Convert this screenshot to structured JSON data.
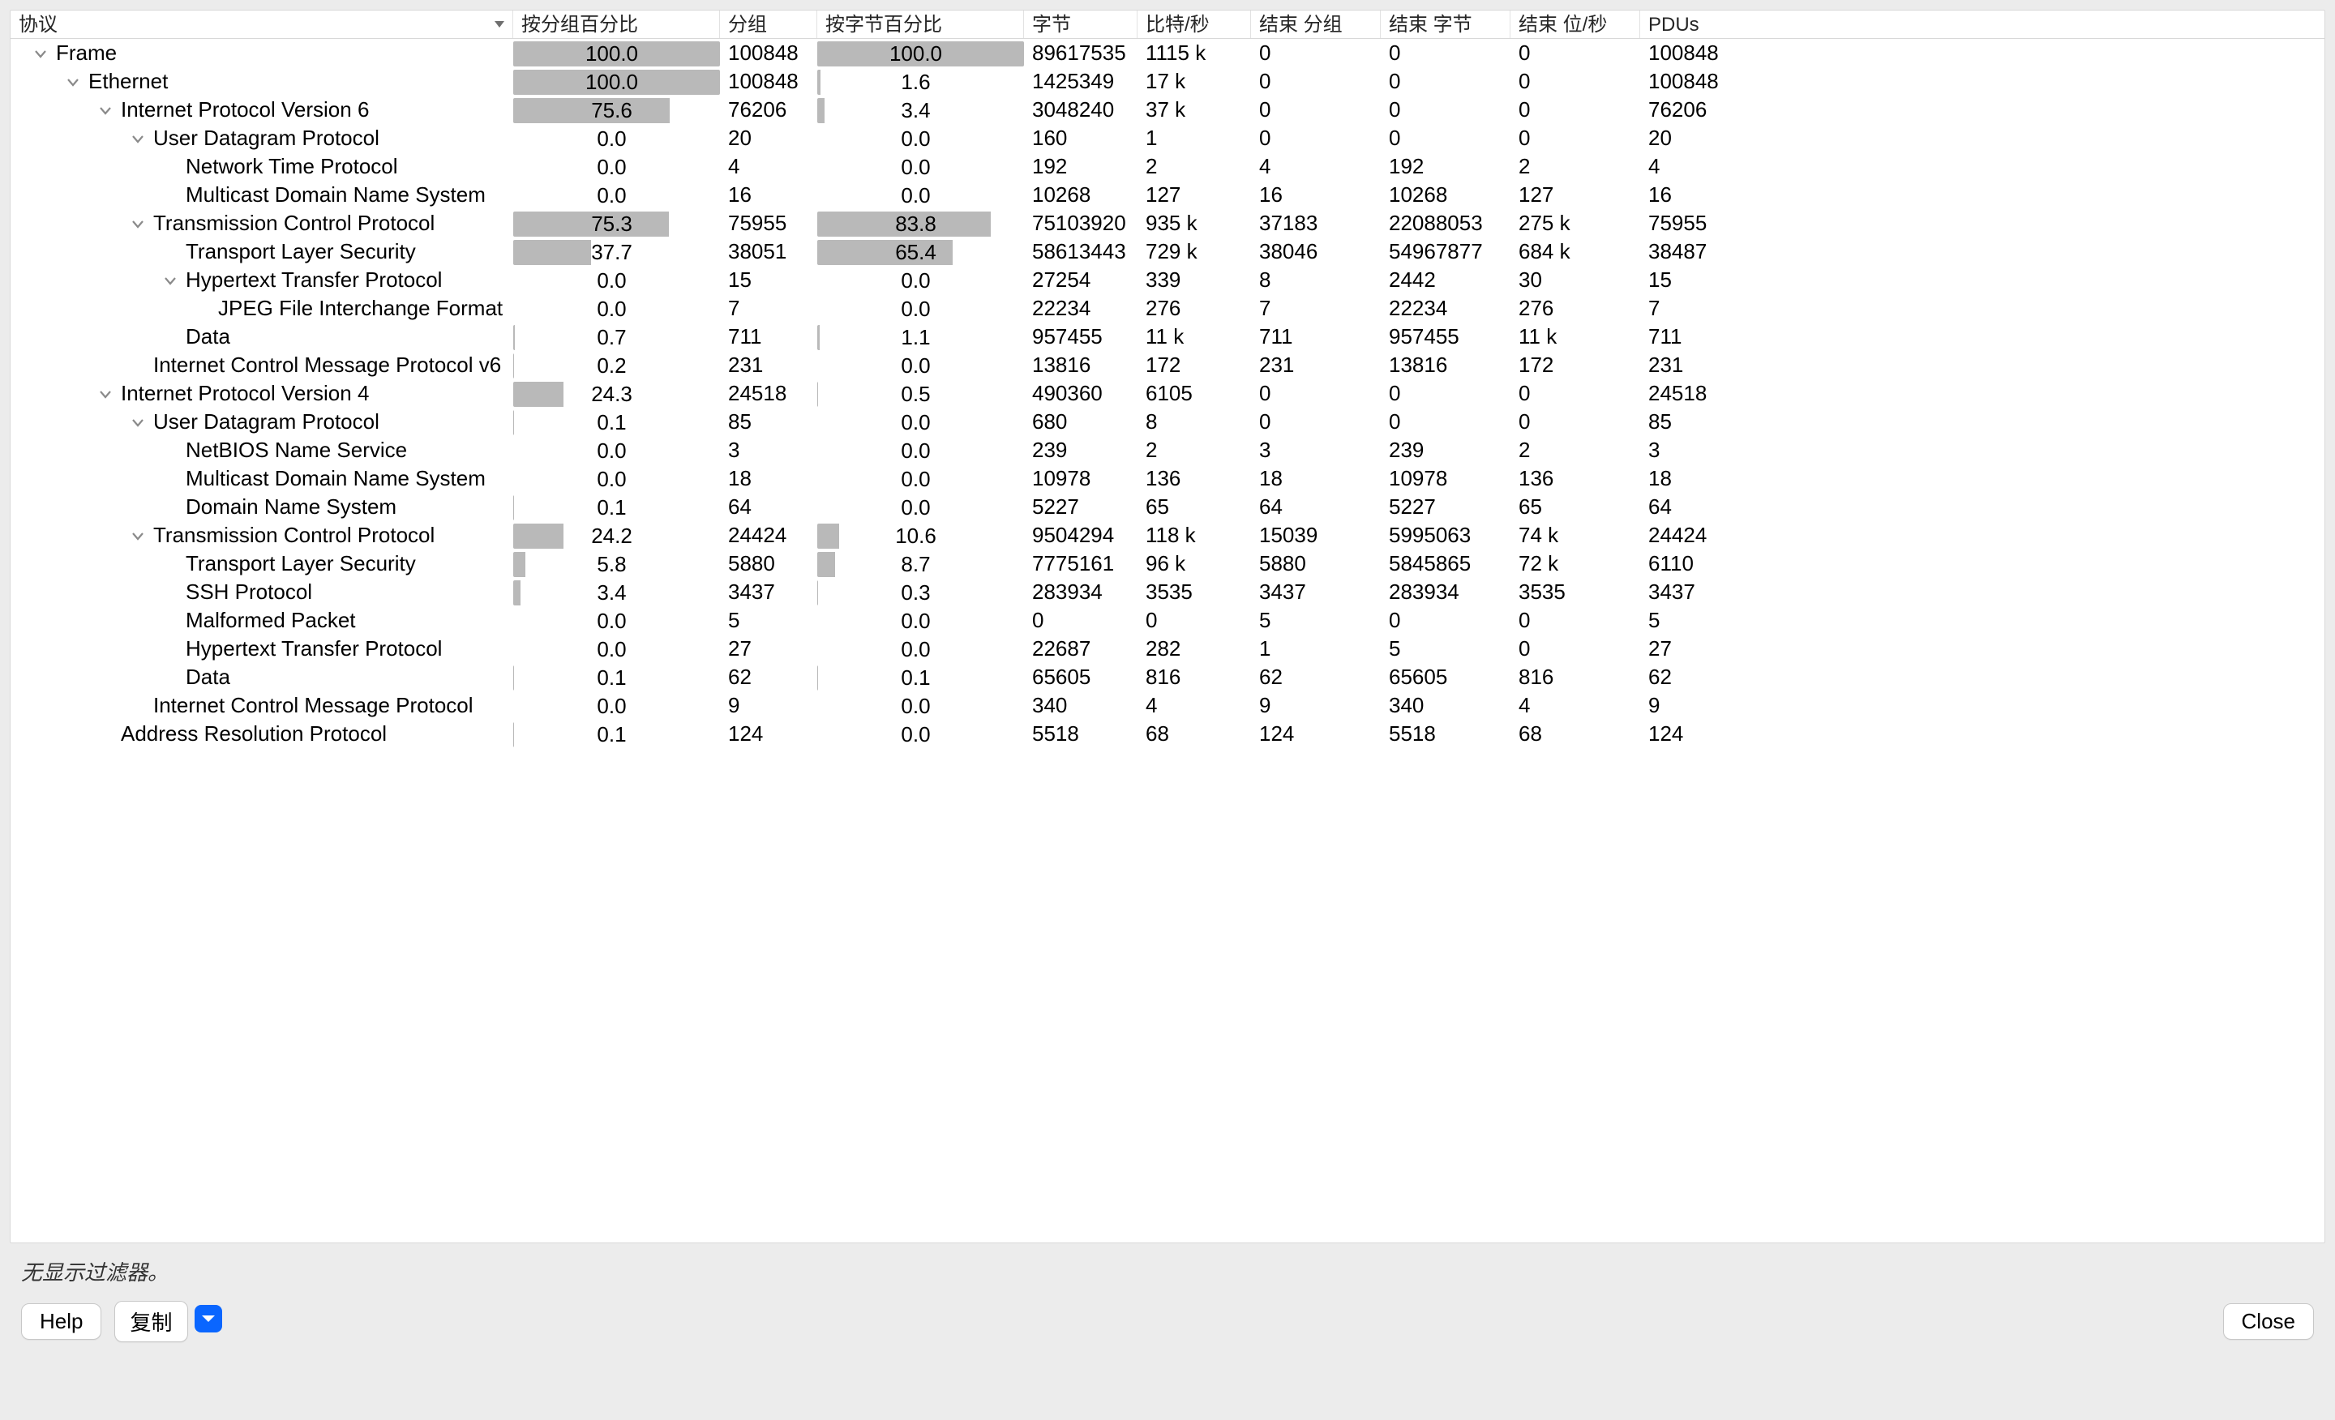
{
  "columns": [
    "协议",
    "按分组百分比",
    "分组",
    "按字节百分比",
    "字节",
    "比特/秒",
    "结束 分组",
    "结束 字节",
    "结束 位/秒",
    "PDUs"
  ],
  "status": "无显示过滤器。",
  "buttons": {
    "help": "Help",
    "copy": "复制",
    "close": "Close"
  },
  "rows": [
    {
      "indent": 0,
      "exp": true,
      "name": "Frame",
      "pct_p": 100.0,
      "packets": "100848",
      "pct_b": 100.0,
      "bytes": "89617535",
      "bps": "1115 k",
      "end_p": "0",
      "end_b": "0",
      "end_bps": "0",
      "pdus": "100848"
    },
    {
      "indent": 1,
      "exp": true,
      "name": "Ethernet",
      "pct_p": 100.0,
      "packets": "100848",
      "pct_b": 1.6,
      "bytes": "1425349",
      "bps": "17 k",
      "end_p": "0",
      "end_b": "0",
      "end_bps": "0",
      "pdus": "100848"
    },
    {
      "indent": 2,
      "exp": true,
      "name": "Internet Protocol Version 6",
      "pct_p": 75.6,
      "packets": "76206",
      "pct_b": 3.4,
      "bytes": "3048240",
      "bps": "37 k",
      "end_p": "0",
      "end_b": "0",
      "end_bps": "0",
      "pdus": "76206"
    },
    {
      "indent": 3,
      "exp": true,
      "name": "User Datagram Protocol",
      "pct_p": 0.0,
      "packets": "20",
      "pct_b": 0.0,
      "bytes": "160",
      "bps": "1",
      "end_p": "0",
      "end_b": "0",
      "end_bps": "0",
      "pdus": "20"
    },
    {
      "indent": 4,
      "exp": null,
      "name": "Network Time Protocol",
      "pct_p": 0.0,
      "packets": "4",
      "pct_b": 0.0,
      "bytes": "192",
      "bps": "2",
      "end_p": "4",
      "end_b": "192",
      "end_bps": "2",
      "pdus": "4"
    },
    {
      "indent": 4,
      "exp": null,
      "name": "Multicast Domain Name System",
      "pct_p": 0.0,
      "packets": "16",
      "pct_b": 0.0,
      "bytes": "10268",
      "bps": "127",
      "end_p": "16",
      "end_b": "10268",
      "end_bps": "127",
      "pdus": "16"
    },
    {
      "indent": 3,
      "exp": true,
      "name": "Transmission Control Protocol",
      "pct_p": 75.3,
      "packets": "75955",
      "pct_b": 83.8,
      "bytes": "75103920",
      "bps": "935 k",
      "end_p": "37183",
      "end_b": "22088053",
      "end_bps": "275 k",
      "pdus": "75955"
    },
    {
      "indent": 4,
      "exp": null,
      "name": "Transport Layer Security",
      "pct_p": 37.7,
      "packets": "38051",
      "pct_b": 65.4,
      "bytes": "58613443",
      "bps": "729 k",
      "end_p": "38046",
      "end_b": "54967877",
      "end_bps": "684 k",
      "pdus": "38487"
    },
    {
      "indent": 4,
      "exp": true,
      "name": "Hypertext Transfer Protocol",
      "pct_p": 0.0,
      "packets": "15",
      "pct_b": 0.0,
      "bytes": "27254",
      "bps": "339",
      "end_p": "8",
      "end_b": "2442",
      "end_bps": "30",
      "pdus": "15"
    },
    {
      "indent": 5,
      "exp": null,
      "name": "JPEG File Interchange Format",
      "pct_p": 0.0,
      "packets": "7",
      "pct_b": 0.0,
      "bytes": "22234",
      "bps": "276",
      "end_p": "7",
      "end_b": "22234",
      "end_bps": "276",
      "pdus": "7"
    },
    {
      "indent": 4,
      "exp": null,
      "name": "Data",
      "pct_p": 0.7,
      "packets": "711",
      "pct_b": 1.1,
      "bytes": "957455",
      "bps": "11 k",
      "end_p": "711",
      "end_b": "957455",
      "end_bps": "11 k",
      "pdus": "711"
    },
    {
      "indent": 3,
      "exp": null,
      "name": "Internet Control Message Protocol v6",
      "pct_p": 0.2,
      "packets": "231",
      "pct_b": 0.0,
      "bytes": "13816",
      "bps": "172",
      "end_p": "231",
      "end_b": "13816",
      "end_bps": "172",
      "pdus": "231"
    },
    {
      "indent": 2,
      "exp": true,
      "name": "Internet Protocol Version 4",
      "pct_p": 24.3,
      "packets": "24518",
      "pct_b": 0.5,
      "bytes": "490360",
      "bps": "6105",
      "end_p": "0",
      "end_b": "0",
      "end_bps": "0",
      "pdus": "24518"
    },
    {
      "indent": 3,
      "exp": true,
      "name": "User Datagram Protocol",
      "pct_p": 0.1,
      "packets": "85",
      "pct_b": 0.0,
      "bytes": "680",
      "bps": "8",
      "end_p": "0",
      "end_b": "0",
      "end_bps": "0",
      "pdus": "85"
    },
    {
      "indent": 4,
      "exp": null,
      "name": "NetBIOS Name Service",
      "pct_p": 0.0,
      "packets": "3",
      "pct_b": 0.0,
      "bytes": "239",
      "bps": "2",
      "end_p": "3",
      "end_b": "239",
      "end_bps": "2",
      "pdus": "3"
    },
    {
      "indent": 4,
      "exp": null,
      "name": "Multicast Domain Name System",
      "pct_p": 0.0,
      "packets": "18",
      "pct_b": 0.0,
      "bytes": "10978",
      "bps": "136",
      "end_p": "18",
      "end_b": "10978",
      "end_bps": "136",
      "pdus": "18"
    },
    {
      "indent": 4,
      "exp": null,
      "name": "Domain Name System",
      "pct_p": 0.1,
      "packets": "64",
      "pct_b": 0.0,
      "bytes": "5227",
      "bps": "65",
      "end_p": "64",
      "end_b": "5227",
      "end_bps": "65",
      "pdus": "64"
    },
    {
      "indent": 3,
      "exp": true,
      "name": "Transmission Control Protocol",
      "pct_p": 24.2,
      "packets": "24424",
      "pct_b": 10.6,
      "bytes": "9504294",
      "bps": "118 k",
      "end_p": "15039",
      "end_b": "5995063",
      "end_bps": "74 k",
      "pdus": "24424"
    },
    {
      "indent": 4,
      "exp": null,
      "name": "Transport Layer Security",
      "pct_p": 5.8,
      "packets": "5880",
      "pct_b": 8.7,
      "bytes": "7775161",
      "bps": "96 k",
      "end_p": "5880",
      "end_b": "5845865",
      "end_bps": "72 k",
      "pdus": "6110"
    },
    {
      "indent": 4,
      "exp": null,
      "name": "SSH Protocol",
      "pct_p": 3.4,
      "packets": "3437",
      "pct_b": 0.3,
      "bytes": "283934",
      "bps": "3535",
      "end_p": "3437",
      "end_b": "283934",
      "end_bps": "3535",
      "pdus": "3437"
    },
    {
      "indent": 4,
      "exp": null,
      "name": "Malformed Packet",
      "pct_p": 0.0,
      "packets": "5",
      "pct_b": 0.0,
      "bytes": "0",
      "bps": "0",
      "end_p": "5",
      "end_b": "0",
      "end_bps": "0",
      "pdus": "5"
    },
    {
      "indent": 4,
      "exp": null,
      "name": "Hypertext Transfer Protocol",
      "pct_p": 0.0,
      "packets": "27",
      "pct_b": 0.0,
      "bytes": "22687",
      "bps": "282",
      "end_p": "1",
      "end_b": "5",
      "end_bps": "0",
      "pdus": "27"
    },
    {
      "indent": 4,
      "exp": null,
      "name": "Data",
      "pct_p": 0.1,
      "packets": "62",
      "pct_b": 0.1,
      "bytes": "65605",
      "bps": "816",
      "end_p": "62",
      "end_b": "65605",
      "end_bps": "816",
      "pdus": "62"
    },
    {
      "indent": 3,
      "exp": null,
      "name": "Internet Control Message Protocol",
      "pct_p": 0.0,
      "packets": "9",
      "pct_b": 0.0,
      "bytes": "340",
      "bps": "4",
      "end_p": "9",
      "end_b": "340",
      "end_bps": "4",
      "pdus": "9"
    },
    {
      "indent": 2,
      "exp": null,
      "name": "Address Resolution Protocol",
      "pct_p": 0.1,
      "packets": "124",
      "pct_b": 0.0,
      "bytes": "5518",
      "bps": "68",
      "end_p": "124",
      "end_b": "5518",
      "end_bps": "68",
      "pdus": "124"
    }
  ]
}
